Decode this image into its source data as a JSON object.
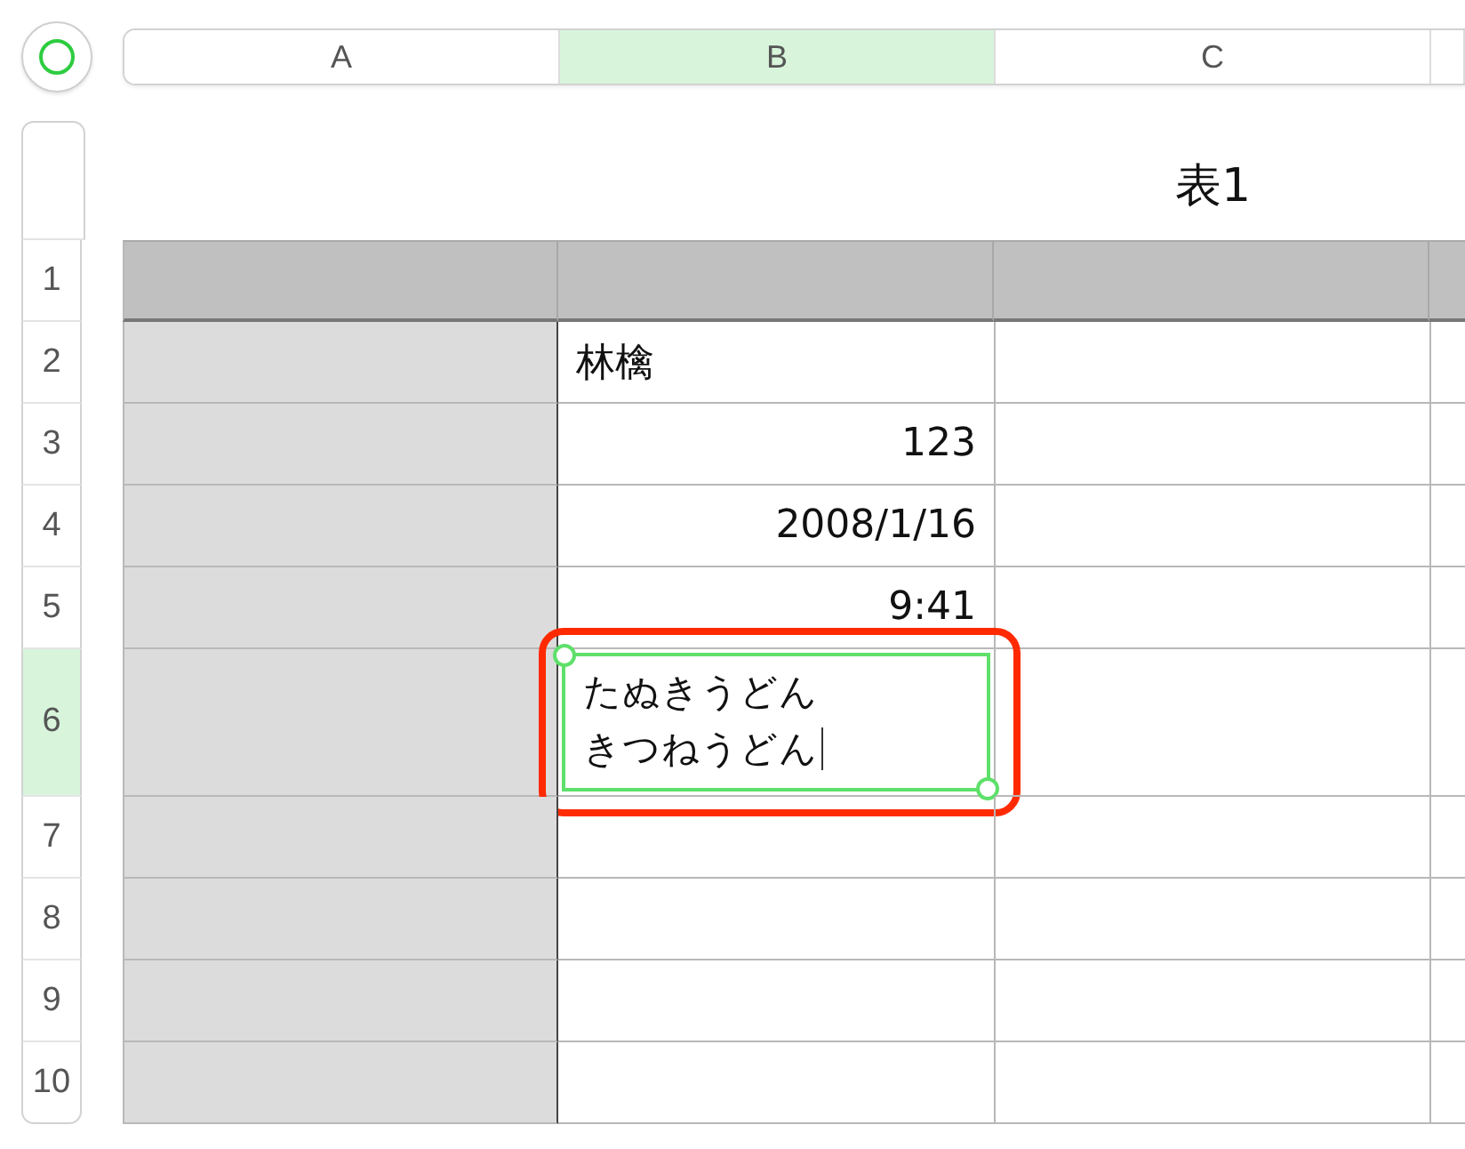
{
  "columns": [
    {
      "label": "A",
      "selected": false
    },
    {
      "label": "B",
      "selected": true
    },
    {
      "label": "C",
      "selected": false
    }
  ],
  "table": {
    "title": "表1",
    "rows": [
      {
        "label": "1",
        "selected": false,
        "kind": "header"
      },
      {
        "label": "2",
        "selected": false,
        "kind": "body",
        "value": {
          "text": "林檎",
          "kind": "text"
        }
      },
      {
        "label": "3",
        "selected": false,
        "kind": "body",
        "value": {
          "text": "123",
          "kind": "number"
        }
      },
      {
        "label": "4",
        "selected": false,
        "kind": "body",
        "value": {
          "text": "2008/1/16",
          "kind": "number"
        }
      },
      {
        "label": "5",
        "selected": false,
        "kind": "body",
        "value": {
          "text": "9:41",
          "kind": "number"
        }
      },
      {
        "label": "6",
        "selected": true,
        "kind": "body",
        "editing": {
          "lines": [
            "たぬきうどん",
            "きつねうどん"
          ],
          "cursor_shown": true,
          "highlighted": true
        }
      },
      {
        "label": "7",
        "selected": false,
        "kind": "body"
      },
      {
        "label": "8",
        "selected": false,
        "kind": "body"
      },
      {
        "label": "9",
        "selected": false,
        "kind": "body"
      },
      {
        "label": "10",
        "selected": false,
        "kind": "body"
      }
    ]
  }
}
